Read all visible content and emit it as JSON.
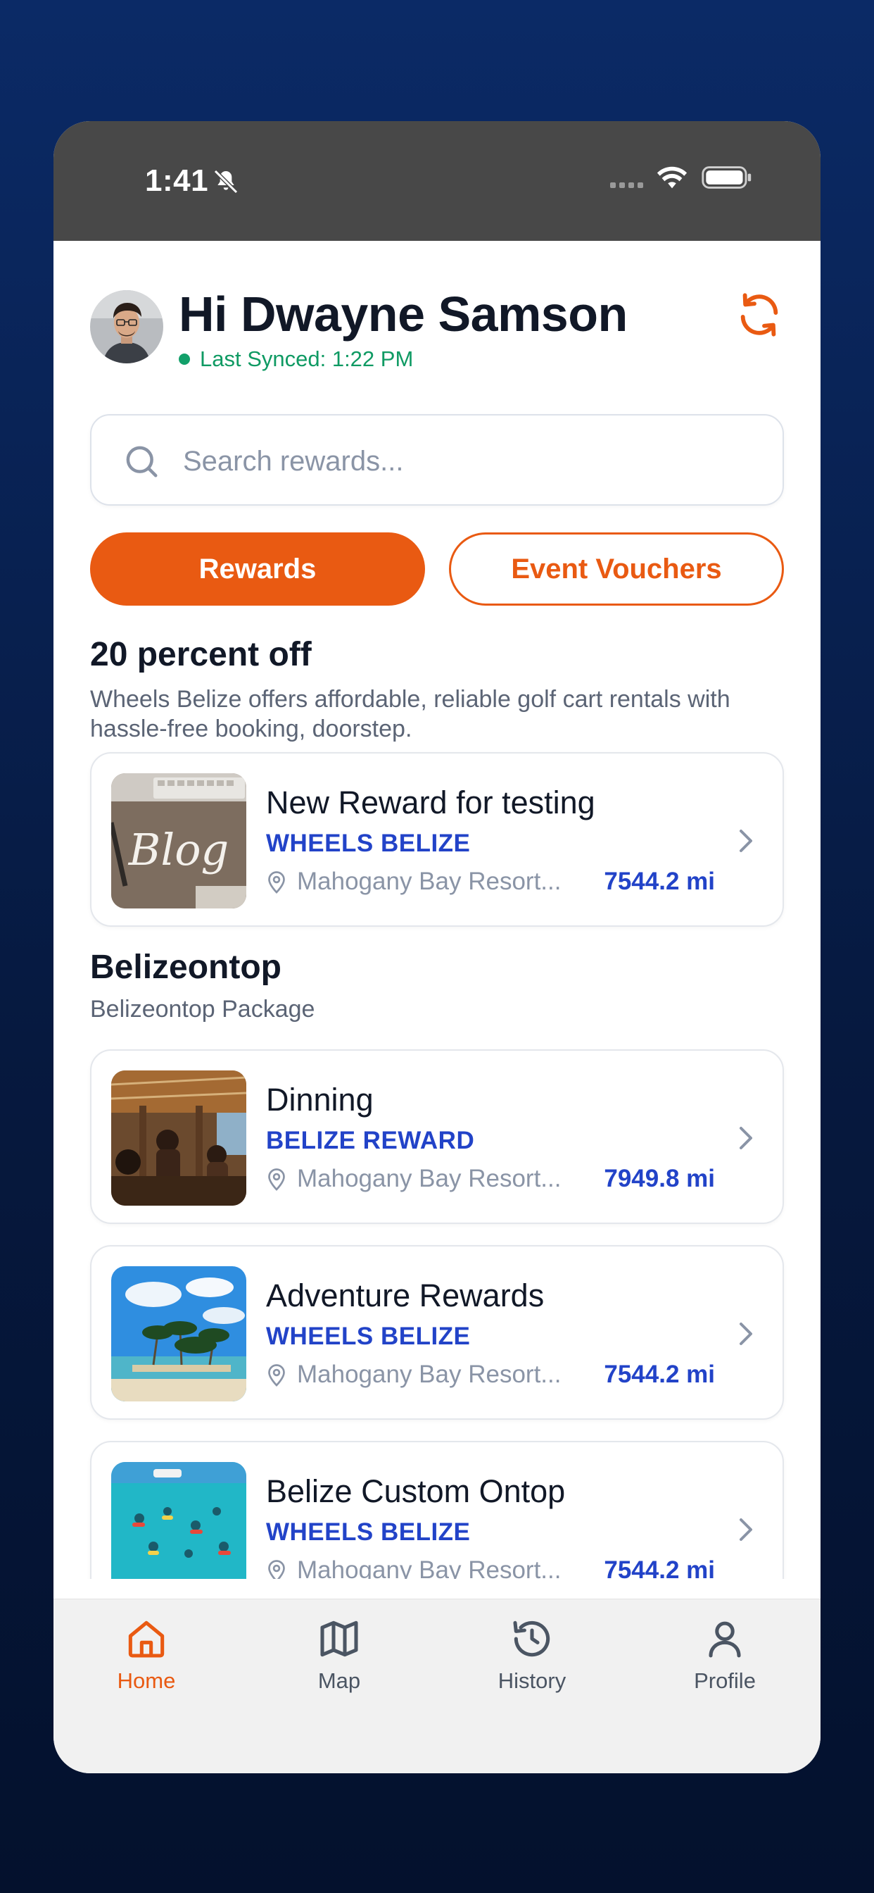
{
  "status_bar": {
    "time": "1:41"
  },
  "header": {
    "greeting": "Hi Dwayne Samson",
    "sync_status": "Last Synced: 1:22 PM"
  },
  "search": {
    "placeholder": "Search rewards..."
  },
  "tabs": [
    {
      "label": "Rewards",
      "active": true
    },
    {
      "label": "Event Vouchers",
      "active": false
    }
  ],
  "sections": [
    {
      "title": "20 percent off",
      "description": "Wheels Belize offers affordable, reliable golf cart rentals with hassle-free booking, doorstep.",
      "cards": [
        {
          "title": "New Reward for testing",
          "brand": "WHEELS BELIZE",
          "location": "Mahogany Bay Resort...",
          "distance": "7544.2 mi",
          "image": "blog-image"
        }
      ]
    },
    {
      "title": "Belizeontop",
      "description": "Belizeontop Package",
      "cards": [
        {
          "title": "Dinning",
          "brand": "BELIZE REWARD",
          "location": "Mahogany Bay Resort...",
          "distance": "7949.8 mi",
          "image": "restaurant-image"
        },
        {
          "title": "Adventure Rewards",
          "brand": "WHEELS BELIZE",
          "location": "Mahogany Bay Resort...",
          "distance": "7544.2 mi",
          "image": "beach-image"
        },
        {
          "title": "Belize Custom Ontop",
          "brand": "WHEELS BELIZE",
          "location": "Mahogany Bay Resort...",
          "distance": "7544.2 mi",
          "image": "snorkel-image"
        }
      ]
    }
  ],
  "tab_bar": [
    {
      "label": "Home",
      "icon": "home-icon",
      "active": true
    },
    {
      "label": "Map",
      "icon": "map-icon",
      "active": false
    },
    {
      "label": "History",
      "icon": "history-icon",
      "active": false
    },
    {
      "label": "Profile",
      "icon": "profile-icon",
      "active": false
    }
  ],
  "colors": {
    "accent": "#e95a12",
    "brand_text": "#2243c8",
    "sync": "#0f9a63",
    "status_bar": "#484848"
  }
}
